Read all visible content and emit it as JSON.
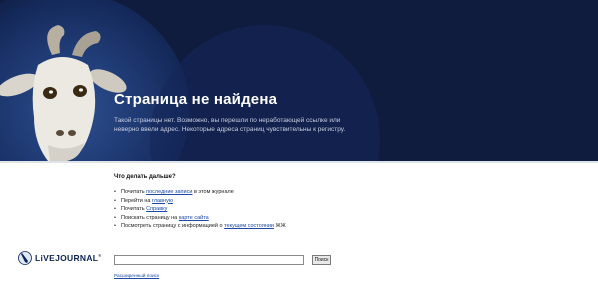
{
  "hero": {
    "title": "Страница не найдена",
    "description": "Такой страницы нет. Возможно, вы перешли по неработающей ссылке или неверно ввели адрес. Некоторые адреса страниц чувствительны к регистру."
  },
  "next": {
    "heading": "Что делать дальше?",
    "items": [
      {
        "pre": "Почитать ",
        "link": "последние записи",
        "post": " в этом журнале"
      },
      {
        "pre": "Перейти на ",
        "link": "главную",
        "post": ""
      },
      {
        "pre": "Почитать ",
        "link": "Справку",
        "post": ""
      },
      {
        "pre": "Поискать страницу на ",
        "link": "карте сайта",
        "post": ""
      },
      {
        "pre": "Посмотреть страницу с информацией о ",
        "link": "текущем состоянии",
        "post": " ЖЖ"
      }
    ]
  },
  "footer": {
    "logo_text": "LiVEJOURNAL",
    "logo_mark": "®",
    "search_value": "",
    "search_button": "Поиск",
    "advanced_search": "Расширенный поиск"
  },
  "colors": {
    "banner": "#0f1c3e",
    "link": "#1a4aa6"
  },
  "icons": {
    "mascot": "goat-icon",
    "logo": "livejournal-pencil-icon"
  }
}
